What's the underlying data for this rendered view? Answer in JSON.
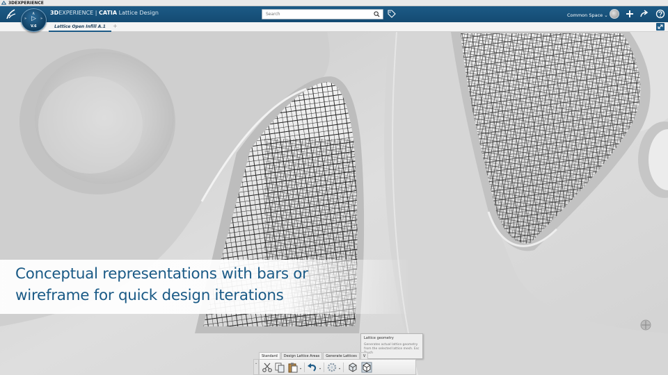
{
  "os_window": {
    "title": "3DEXPERIENCE"
  },
  "topbar": {
    "brand_bold": "3D",
    "brand_rest": "EXPERIENCE",
    "brand_app": "CATIA",
    "brand_module": "Lattice Design",
    "search_placeholder": "Search",
    "space_label": "Common Space",
    "icons": [
      "ds-logo-icon",
      "search-icon",
      "tag-icon",
      "avatar",
      "plus-icon",
      "share-icon",
      "help-icon"
    ]
  },
  "compass": {
    "version": "V.6",
    "play": "▷",
    "left": "»",
    "right": "»",
    "top": "∧"
  },
  "tabs": {
    "active_label": "Lattice Open Infill A.1",
    "add_label": "+"
  },
  "caption": {
    "line1": "Conceptual representations with bars or",
    "line2": "wireframe for quick design iterations"
  },
  "tooltip": {
    "title": "Lattice geometry",
    "description": "Generates actual lattice geometry from the selected lattice mesh.   Esc   Touch"
  },
  "actionbar": {
    "collapse_label": "⌄",
    "tabs": [
      "Standard",
      "Design Lattice Areas",
      "Generate Lattices",
      "V"
    ],
    "tools": [
      "cut-icon",
      "copy-icon",
      "paste-icon",
      "undo-icon",
      "settings-icon",
      "lattice-bars-icon",
      "lattice-geometry-icon"
    ]
  },
  "colors": {
    "brand_blue": "#1c5a86",
    "caption_text": "#1a5a86",
    "lattice_dark": "#1e1e1e"
  }
}
